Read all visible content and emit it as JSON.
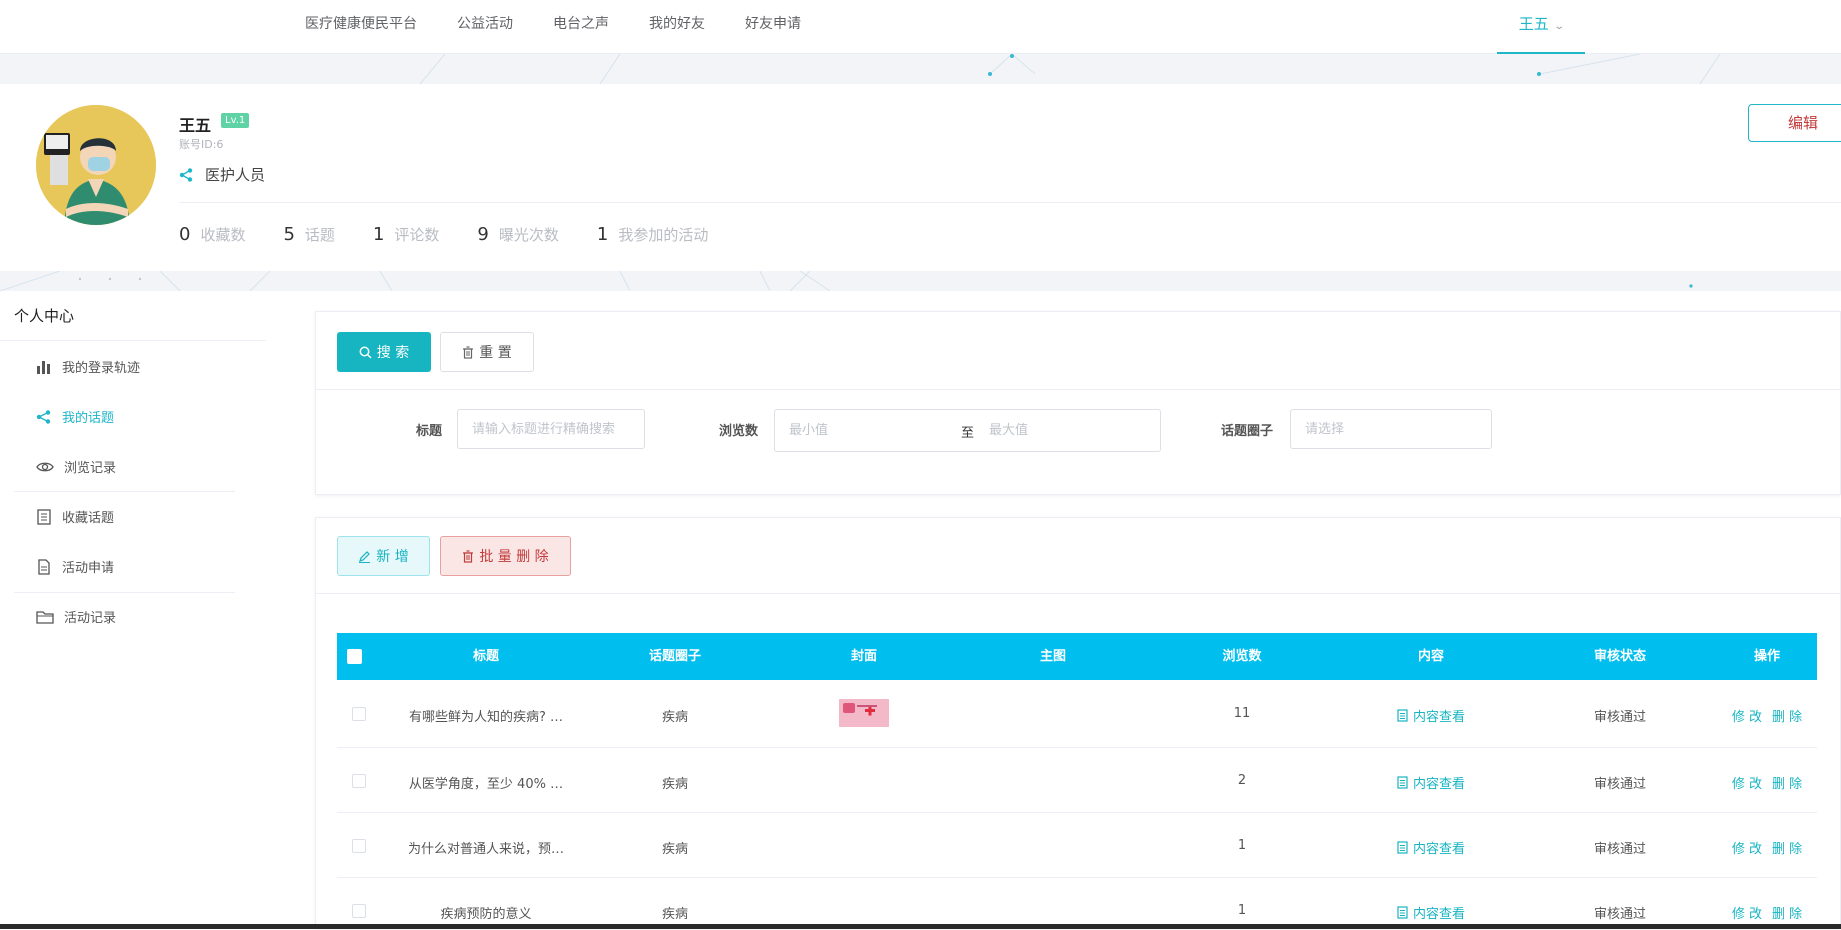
{
  "nav": {
    "items": [
      "医疗健康便民平台",
      "公益活动",
      "电台之声",
      "我的好友",
      "好友申请"
    ],
    "user": "王五"
  },
  "profile": {
    "name": "王五",
    "level": "Lv.1",
    "account": "账号ID:6",
    "role": "医护人员",
    "edit_label": "编辑",
    "stats": [
      {
        "num": "0",
        "label": "收藏数"
      },
      {
        "num": "5",
        "label": "话题"
      },
      {
        "num": "1",
        "label": "评论数"
      },
      {
        "num": "9",
        "label": "曝光次数"
      },
      {
        "num": "1",
        "label": "我参加的活动"
      }
    ]
  },
  "sidebar": {
    "title": "个人中心",
    "items": [
      {
        "label": "我的登录轨迹",
        "icon": "bar-chart-icon"
      },
      {
        "label": "我的话题",
        "icon": "share-icon",
        "active": true
      },
      {
        "label": "浏览记录",
        "icon": "eye-icon"
      },
      {
        "label": "收藏话题",
        "icon": "document-icon"
      },
      {
        "label": "活动申请",
        "icon": "file-icon"
      },
      {
        "label": "活动记录",
        "icon": "folder-icon"
      }
    ]
  },
  "search": {
    "search_label": "搜 索",
    "reset_label": "重 置",
    "title_label": "标题",
    "title_placeholder": "请输入标题进行精确搜索",
    "views_label": "浏览数",
    "min_placeholder": "最小值",
    "range_sep": "至",
    "max_placeholder": "最大值",
    "circle_label": "话题圈子",
    "circle_placeholder": "请选择"
  },
  "table": {
    "add_label": "新 增",
    "bulk_delete_label": "批 量 删 除",
    "columns": [
      "标题",
      "话题圈子",
      "封面",
      "主图",
      "浏览数",
      "内容",
      "审核状态",
      "操作"
    ],
    "rows": [
      {
        "title": "有哪些鲜为人知的疾病? …",
        "circle": "疾病",
        "cover": true,
        "views": "11",
        "content": "内容查看",
        "status": "审核通过"
      },
      {
        "title": "从医学角度，至少 40% …",
        "circle": "疾病",
        "cover": false,
        "views": "2",
        "content": "内容查看",
        "status": "审核通过"
      },
      {
        "title": "为什么对普通人来说，预…",
        "circle": "疾病",
        "cover": false,
        "views": "1",
        "content": "内容查看",
        "status": "审核通过"
      },
      {
        "title": "疾病预防的意义",
        "circle": "疾病",
        "cover": false,
        "views": "1",
        "content": "内容查看",
        "status": "审核通过"
      }
    ],
    "edit_label": "修 改",
    "delete_label": "删 除"
  },
  "colors": {
    "accent": "#17b4c2",
    "header": "#00bfef",
    "danger": "#c23b3b"
  }
}
